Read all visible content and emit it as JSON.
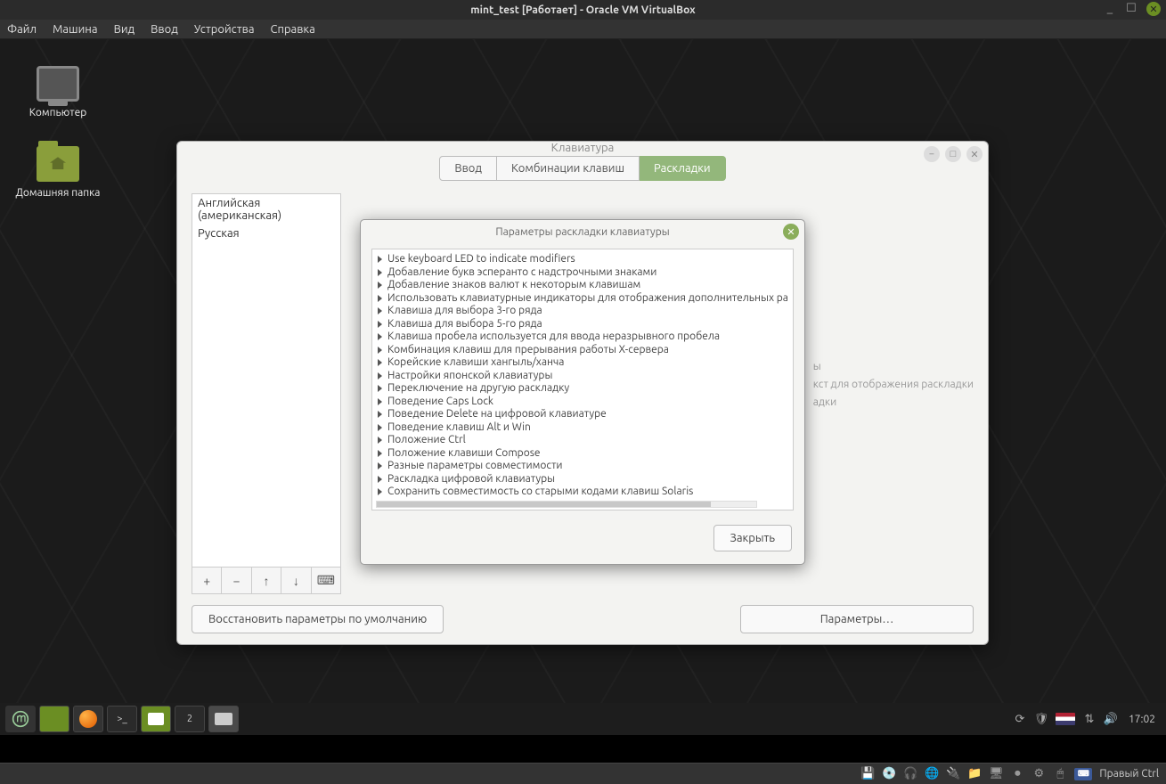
{
  "vb": {
    "title": "mint_test [Работает] - Oracle VM VirtualBox",
    "menu": [
      "Файл",
      "Машина",
      "Вид",
      "Ввод",
      "Устройства",
      "Справка"
    ],
    "hostkey": "Правый Ctrl"
  },
  "desktop": {
    "icon_computer": "Компьютер",
    "icon_home": "Домашняя папка"
  },
  "kbwin": {
    "title": "Клавиатура",
    "tabs": {
      "input": "Ввод",
      "shortcuts": "Комбинации клавиш",
      "layouts": "Раскладки"
    },
    "layouts": [
      "Английская (американская)",
      "Русская"
    ],
    "right_hint_1": "ы",
    "right_hint_2": "кст для отображения раскладки",
    "right_hint_3": "адки",
    "restore_btn": "Восстановить параметры по умолчанию",
    "params_btn": "Параметры…",
    "toolbar": {
      "add": "+",
      "remove": "−",
      "up": "↑",
      "down": "↓",
      "kbd": "⌨"
    }
  },
  "modal": {
    "title": "Параметры раскладки клавиатуры",
    "items": [
      "Use keyboard LED to indicate modifiers",
      "Добавление букв эсперанто с надстрочными знаками",
      "Добавление знаков валют к некоторым клавишам",
      "Использовать клавиатурные индикаторы для отображения дополнительных ра",
      "Клавиша для выбора 3-го ряда",
      "Клавиша для выбора 5-го ряда",
      "Клавиша пробела используется для ввода неразрывного пробела",
      "Комбинация клавиш для прерывания работы X-сервера",
      "Корейские клавиши хангыль/ханча",
      "Настройки японской клавиатуры",
      "Переключение на другую раскладку",
      "Поведение Caps Lock",
      "Поведение Delete на цифровой клавиатуре",
      "Поведение клавиш Alt и Win",
      "Положение Ctrl",
      "Положение клавиши Compose",
      "Разные параметры совместимости",
      "Раскладка цифровой клавиатуры",
      "Сохранить совместимость со старыми кодами клавиш Solaris"
    ],
    "close_btn": "Закрыть"
  },
  "mintbar": {
    "workspace_count": "2",
    "clock": "17:02"
  },
  "tray": {
    "lang": "US"
  }
}
